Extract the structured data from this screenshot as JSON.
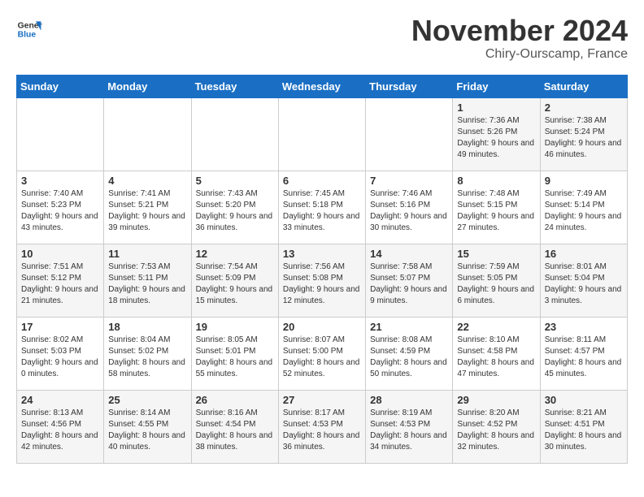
{
  "header": {
    "logo_line1": "General",
    "logo_line2": "Blue",
    "month": "November 2024",
    "location": "Chiry-Ourscamp, France"
  },
  "weekdays": [
    "Sunday",
    "Monday",
    "Tuesday",
    "Wednesday",
    "Thursday",
    "Friday",
    "Saturday"
  ],
  "weeks": [
    [
      {
        "day": "",
        "info": ""
      },
      {
        "day": "",
        "info": ""
      },
      {
        "day": "",
        "info": ""
      },
      {
        "day": "",
        "info": ""
      },
      {
        "day": "",
        "info": ""
      },
      {
        "day": "1",
        "info": "Sunrise: 7:36 AM\nSunset: 5:26 PM\nDaylight: 9 hours and 49 minutes."
      },
      {
        "day": "2",
        "info": "Sunrise: 7:38 AM\nSunset: 5:24 PM\nDaylight: 9 hours and 46 minutes."
      }
    ],
    [
      {
        "day": "3",
        "info": "Sunrise: 7:40 AM\nSunset: 5:23 PM\nDaylight: 9 hours and 43 minutes."
      },
      {
        "day": "4",
        "info": "Sunrise: 7:41 AM\nSunset: 5:21 PM\nDaylight: 9 hours and 39 minutes."
      },
      {
        "day": "5",
        "info": "Sunrise: 7:43 AM\nSunset: 5:20 PM\nDaylight: 9 hours and 36 minutes."
      },
      {
        "day": "6",
        "info": "Sunrise: 7:45 AM\nSunset: 5:18 PM\nDaylight: 9 hours and 33 minutes."
      },
      {
        "day": "7",
        "info": "Sunrise: 7:46 AM\nSunset: 5:16 PM\nDaylight: 9 hours and 30 minutes."
      },
      {
        "day": "8",
        "info": "Sunrise: 7:48 AM\nSunset: 5:15 PM\nDaylight: 9 hours and 27 minutes."
      },
      {
        "day": "9",
        "info": "Sunrise: 7:49 AM\nSunset: 5:14 PM\nDaylight: 9 hours and 24 minutes."
      }
    ],
    [
      {
        "day": "10",
        "info": "Sunrise: 7:51 AM\nSunset: 5:12 PM\nDaylight: 9 hours and 21 minutes."
      },
      {
        "day": "11",
        "info": "Sunrise: 7:53 AM\nSunset: 5:11 PM\nDaylight: 9 hours and 18 minutes."
      },
      {
        "day": "12",
        "info": "Sunrise: 7:54 AM\nSunset: 5:09 PM\nDaylight: 9 hours and 15 minutes."
      },
      {
        "day": "13",
        "info": "Sunrise: 7:56 AM\nSunset: 5:08 PM\nDaylight: 9 hours and 12 minutes."
      },
      {
        "day": "14",
        "info": "Sunrise: 7:58 AM\nSunset: 5:07 PM\nDaylight: 9 hours and 9 minutes."
      },
      {
        "day": "15",
        "info": "Sunrise: 7:59 AM\nSunset: 5:05 PM\nDaylight: 9 hours and 6 minutes."
      },
      {
        "day": "16",
        "info": "Sunrise: 8:01 AM\nSunset: 5:04 PM\nDaylight: 9 hours and 3 minutes."
      }
    ],
    [
      {
        "day": "17",
        "info": "Sunrise: 8:02 AM\nSunset: 5:03 PM\nDaylight: 9 hours and 0 minutes."
      },
      {
        "day": "18",
        "info": "Sunrise: 8:04 AM\nSunset: 5:02 PM\nDaylight: 8 hours and 58 minutes."
      },
      {
        "day": "19",
        "info": "Sunrise: 8:05 AM\nSunset: 5:01 PM\nDaylight: 8 hours and 55 minutes."
      },
      {
        "day": "20",
        "info": "Sunrise: 8:07 AM\nSunset: 5:00 PM\nDaylight: 8 hours and 52 minutes."
      },
      {
        "day": "21",
        "info": "Sunrise: 8:08 AM\nSunset: 4:59 PM\nDaylight: 8 hours and 50 minutes."
      },
      {
        "day": "22",
        "info": "Sunrise: 8:10 AM\nSunset: 4:58 PM\nDaylight: 8 hours and 47 minutes."
      },
      {
        "day": "23",
        "info": "Sunrise: 8:11 AM\nSunset: 4:57 PM\nDaylight: 8 hours and 45 minutes."
      }
    ],
    [
      {
        "day": "24",
        "info": "Sunrise: 8:13 AM\nSunset: 4:56 PM\nDaylight: 8 hours and 42 minutes."
      },
      {
        "day": "25",
        "info": "Sunrise: 8:14 AM\nSunset: 4:55 PM\nDaylight: 8 hours and 40 minutes."
      },
      {
        "day": "26",
        "info": "Sunrise: 8:16 AM\nSunset: 4:54 PM\nDaylight: 8 hours and 38 minutes."
      },
      {
        "day": "27",
        "info": "Sunrise: 8:17 AM\nSunset: 4:53 PM\nDaylight: 8 hours and 36 minutes."
      },
      {
        "day": "28",
        "info": "Sunrise: 8:19 AM\nSunset: 4:53 PM\nDaylight: 8 hours and 34 minutes."
      },
      {
        "day": "29",
        "info": "Sunrise: 8:20 AM\nSunset: 4:52 PM\nDaylight: 8 hours and 32 minutes."
      },
      {
        "day": "30",
        "info": "Sunrise: 8:21 AM\nSunset: 4:51 PM\nDaylight: 8 hours and 30 minutes."
      }
    ]
  ]
}
